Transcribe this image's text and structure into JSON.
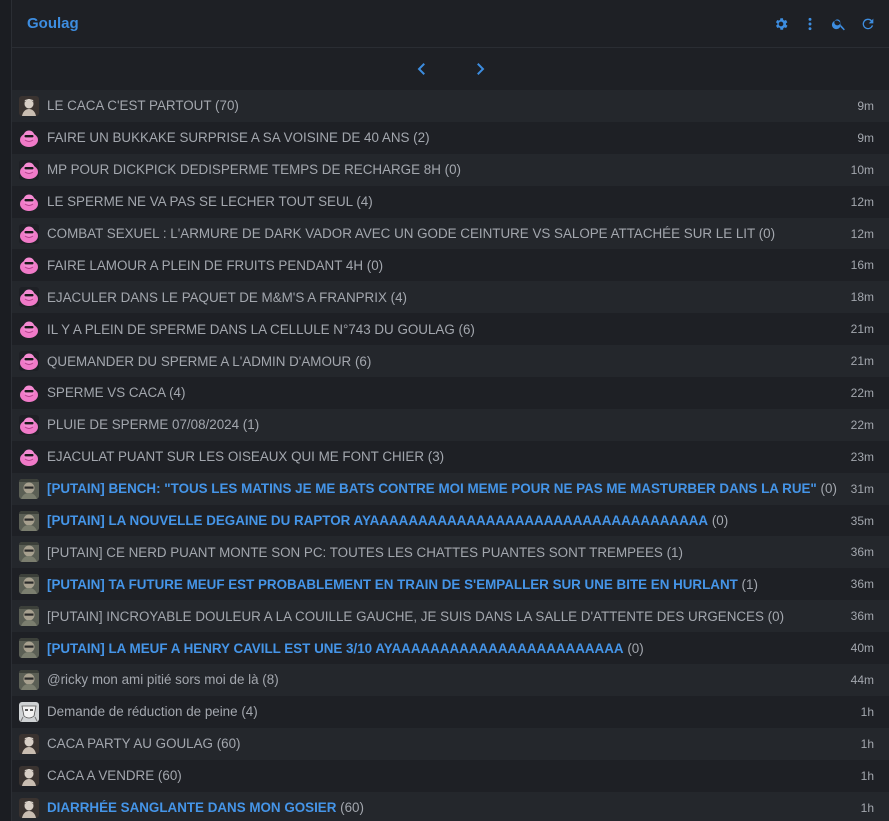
{
  "header": {
    "title": "Goulag",
    "icons": [
      "gear-icon",
      "more-vertical-icon",
      "search-icon",
      "refresh-icon"
    ]
  },
  "pager": {
    "prev_icon": "chevron-left-icon",
    "next_icon": "chevron-right-icon"
  },
  "topics": [
    {
      "title": "LE CACA C'EST PARTOUT",
      "count": "(70)",
      "time": "9m",
      "avatar": "portrait",
      "highlight": false
    },
    {
      "title": "FAIRE UN BUKKAKE SURPRISE A SA VOISINE DE 40 ANS",
      "count": "(2)",
      "time": "9m",
      "avatar": "pink",
      "highlight": false
    },
    {
      "title": "MP POUR DICKPICK DEDISPERME TEMPS DE RECHARGE 8H",
      "count": "(0)",
      "time": "10m",
      "avatar": "pink",
      "highlight": false
    },
    {
      "title": "LE SPERME NE VA PAS SE LECHER TOUT SEUL",
      "count": "(4)",
      "time": "12m",
      "avatar": "pink",
      "highlight": false
    },
    {
      "title": "COMBAT SEXUEL : L'ARMURE DE DARK VADOR AVEC UN GODE CEINTURE VS SALOPE ATTACHÉE SUR LE LIT",
      "count": "(0)",
      "time": "12m",
      "avatar": "pink",
      "highlight": false
    },
    {
      "title": "FAIRE LAMOUR A PLEIN DE FRUITS PENDANT 4H",
      "count": "(0)",
      "time": "16m",
      "avatar": "pink",
      "highlight": false
    },
    {
      "title": "EJACULER DANS LE PAQUET DE M&M'S A FRANPRIX",
      "count": "(4)",
      "time": "18m",
      "avatar": "pink",
      "highlight": false
    },
    {
      "title": "IL Y A PLEIN DE SPERME DANS LA CELLULE N°743 DU GOULAG",
      "count": "(6)",
      "time": "21m",
      "avatar": "pink",
      "highlight": false
    },
    {
      "title": "QUEMANDER DU SPERME A L'ADMIN D'AMOUR",
      "count": "(6)",
      "time": "21m",
      "avatar": "pink",
      "highlight": false
    },
    {
      "title": "SPERME VS CACA",
      "count": "(4)",
      "time": "22m",
      "avatar": "pink",
      "highlight": false
    },
    {
      "title": "PLUIE DE SPERME 07/08/2024",
      "count": "(1)",
      "time": "22m",
      "avatar": "pink",
      "highlight": false
    },
    {
      "title": "EJACULAT PUANT SUR LES OISEAUX QUI ME FONT CHIER",
      "count": "(3)",
      "time": "23m",
      "avatar": "pink",
      "highlight": false
    },
    {
      "title": "[PUTAIN] BENCH: \"TOUS LES MATINS JE ME BATS CONTRE MOI MEME POUR NE PAS ME MASTURBER DANS LA RUE\"",
      "count": "(0)",
      "time": "31m",
      "avatar": "rock",
      "highlight": true
    },
    {
      "title": "[PUTAIN] LA NOUVELLE DEGAINE DU RAPTOR AYAAAAAAAAAAAAAAAAAAAAAAAAAAAAAAAAAAA",
      "count": "(0)",
      "time": "35m",
      "avatar": "rock",
      "highlight": true
    },
    {
      "title": "[PUTAIN] CE NERD PUANT MONTE SON PC: TOUTES LES CHATTES PUANTES SONT TREMPEES",
      "count": "(1)",
      "time": "36m",
      "avatar": "rock",
      "highlight": false
    },
    {
      "title": "[PUTAIN] TA FUTURE MEUF EST PROBABLEMENT EN TRAIN DE S'EMPALLER SUR UNE BITE EN HURLANT",
      "count": "(1)",
      "time": "36m",
      "avatar": "rock",
      "highlight": true
    },
    {
      "title": "[PUTAIN] INCROYABLE DOULEUR A LA COUILLE GAUCHE, JE SUIS DANS LA SALLE D'ATTENTE DES URGENCES",
      "count": "(0)",
      "time": "36m",
      "avatar": "rock",
      "highlight": false
    },
    {
      "title": "[PUTAIN] LA MEUF A HENRY CAVILL EST UNE 3/10 AYAAAAAAAAAAAAAAAAAAAAAAAA",
      "count": "(0)",
      "time": "40m",
      "avatar": "rock",
      "highlight": true
    },
    {
      "title": "@ricky mon ami pitié sors moi de là",
      "count": "(8)",
      "time": "44m",
      "avatar": "rock",
      "highlight": false
    },
    {
      "title": "Demande de réduction de peine",
      "count": "(4)",
      "time": "1h",
      "avatar": "mask",
      "highlight": false
    },
    {
      "title": "CACA PARTY AU GOULAG",
      "count": "(60)",
      "time": "1h",
      "avatar": "portrait",
      "highlight": false
    },
    {
      "title": "CACA A VENDRE",
      "count": "(60)",
      "time": "1h",
      "avatar": "portrait",
      "highlight": false
    },
    {
      "title": "DIARRHÉE SANGLANTE DANS MON GOSIER",
      "count": "(60)",
      "time": "1h",
      "avatar": "portrait",
      "highlight": true
    }
  ]
}
